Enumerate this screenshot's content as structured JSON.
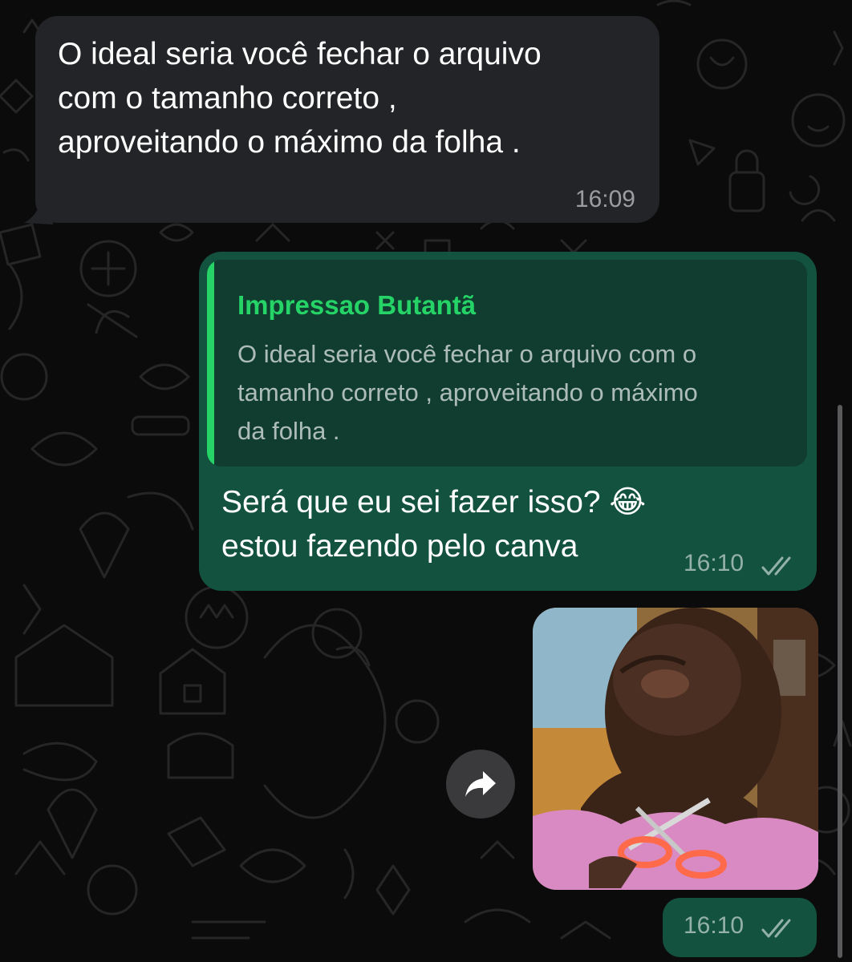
{
  "messages": {
    "incoming": {
      "text": "O ideal seria você fechar o arquivo\ncom o tamanho correto ,\naproveitando o máximo da folha .",
      "time": "16:09"
    },
    "reply": {
      "quoted_author": "Impressao Butantã",
      "quoted_text": "O ideal seria você fechar o arquivo com o\ntamanho correto , aproveitando o máximo\nda folha .",
      "text": "Será que eu sei fazer isso? 😂\nestou fazendo pelo canva",
      "time": "16:10",
      "status_icon": "double-check-icon"
    },
    "image": {
      "time": "16:10",
      "status_icon": "double-check-icon"
    }
  },
  "icons": {
    "forward": "forward-arrow-icon"
  },
  "colors": {
    "background": "#0b0b0b",
    "incoming_bubble": "#232427",
    "outgoing_bubble": "#13523e",
    "quote_background": "#103d30",
    "accent": "#25d366"
  }
}
